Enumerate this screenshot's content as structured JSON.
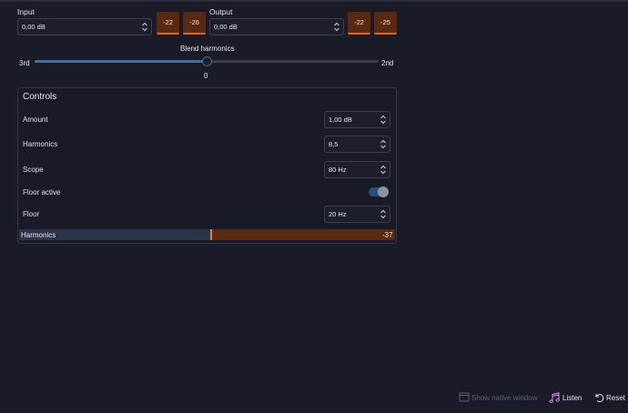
{
  "input": {
    "label": "Input",
    "value": "0,00 dB",
    "meter_left": "-22",
    "meter_right": "-26"
  },
  "output": {
    "label": "Output",
    "value": "0,00 dB",
    "meter_left": "-22",
    "meter_right": "-25"
  },
  "blend": {
    "title": "Blend harmonics",
    "left_label": "3rd",
    "right_label": "2nd",
    "value": "0",
    "position_fraction": 0.5
  },
  "controls": {
    "title": "Controls",
    "amount": {
      "label": "Amount",
      "value": "1,00 dB"
    },
    "harmonics": {
      "label": "Harmonics",
      "value": "8,5"
    },
    "scope": {
      "label": "Scope",
      "value": "80 Hz"
    },
    "floor_active": {
      "label": "Floor active",
      "on": true
    },
    "floor": {
      "label": "Floor",
      "value": "20 Hz"
    },
    "harmonics_meter": {
      "label": "Harmonics",
      "value": "-37",
      "position_fraction": 0.5
    }
  },
  "footer": {
    "show_native": "Show native window",
    "listen": "Listen",
    "reset": "Reset"
  },
  "colors": {
    "background": "#191c28",
    "meter_bg": "#5a2a10",
    "meter_accent": "#e2651e",
    "slider_accent": "#3f6ea6",
    "listen_icon": "#c07ee8"
  }
}
